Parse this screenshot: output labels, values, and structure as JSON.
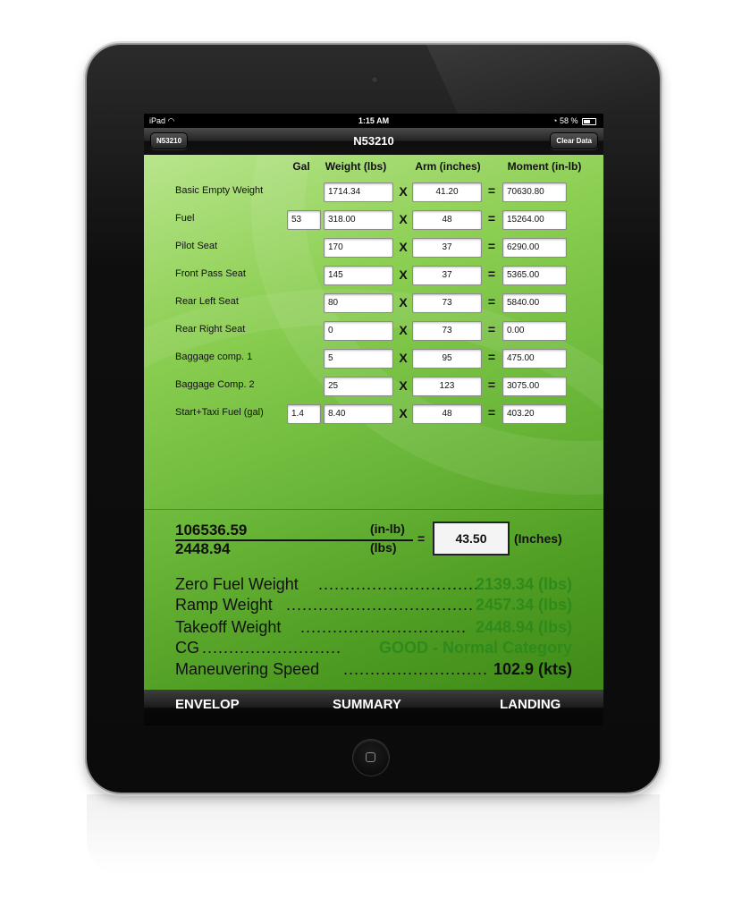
{
  "status_bar": {
    "carrier": "iPad",
    "time": "1:15 AM",
    "battery": "58 %"
  },
  "nav": {
    "left_button": "N53210",
    "title": "N53210",
    "right_button": "Clear Data"
  },
  "table": {
    "headers": {
      "gal": "Gal",
      "weight": "Weight (lbs)",
      "arm": "Arm (inches)",
      "moment": "Moment (in-lb)"
    },
    "operators": {
      "times": "X",
      "equals": "="
    },
    "rows": [
      {
        "label": "Basic Empty Weight",
        "gal": "",
        "weight": "1714.34",
        "arm": "41.20",
        "moment": "70630.80"
      },
      {
        "label": "Fuel",
        "gal": "53",
        "weight": "318.00",
        "arm": "48",
        "moment": "15264.00"
      },
      {
        "label": "Pilot Seat",
        "gal": "",
        "weight": "170",
        "arm": "37",
        "moment": "6290.00"
      },
      {
        "label": "Front Pass Seat",
        "gal": "",
        "weight": "145",
        "arm": "37",
        "moment": "5365.00"
      },
      {
        "label": "Rear Left Seat",
        "gal": "",
        "weight": "80",
        "arm": "73",
        "moment": "5840.00"
      },
      {
        "label": "Rear Right Seat",
        "gal": "",
        "weight": "0",
        "arm": "73",
        "moment": "0.00"
      },
      {
        "label": "Baggage comp. 1",
        "gal": "",
        "weight": "5",
        "arm": "95",
        "moment": "475.00"
      },
      {
        "label": "Baggage Comp. 2",
        "gal": "",
        "weight": "25",
        "arm": "123",
        "moment": "3075.00"
      },
      {
        "label": "Start+Taxi Fuel (gal)",
        "gal": "1.4",
        "weight": "8.40",
        "arm": "48",
        "moment": "403.20"
      }
    ]
  },
  "cg_calc": {
    "total_moment": "106536.59",
    "total_weight": "2448.94",
    "moment_unit": "(in-lb)",
    "weight_unit": "(lbs)",
    "equals": "=",
    "cg_value": "43.50",
    "cg_unit": "(Inches)"
  },
  "summary": [
    {
      "label": "Zero Fuel Weight",
      "dots": "..............................",
      "value": "2139.34 (lbs)"
    },
    {
      "label": "Ramp Weight",
      "dots": "...................................",
      "value": "2457.34 (lbs)"
    },
    {
      "label": "Takeoff Weight",
      "dots": "...............................",
      "value": "2448.94 (lbs)"
    },
    {
      "label": "CG",
      "dots": "..........................",
      "value": "GOOD - Normal Category"
    },
    {
      "label": "Maneuvering Speed",
      "dots": "...........................",
      "value": "102.9 (kts)"
    }
  ],
  "tabs": {
    "envelop": "ENVELOP",
    "summary": "SUMMARY",
    "landing": "LANDING"
  },
  "colors": {
    "accent_green": "#2f8a1c",
    "screen_green": "#6cb83a"
  }
}
